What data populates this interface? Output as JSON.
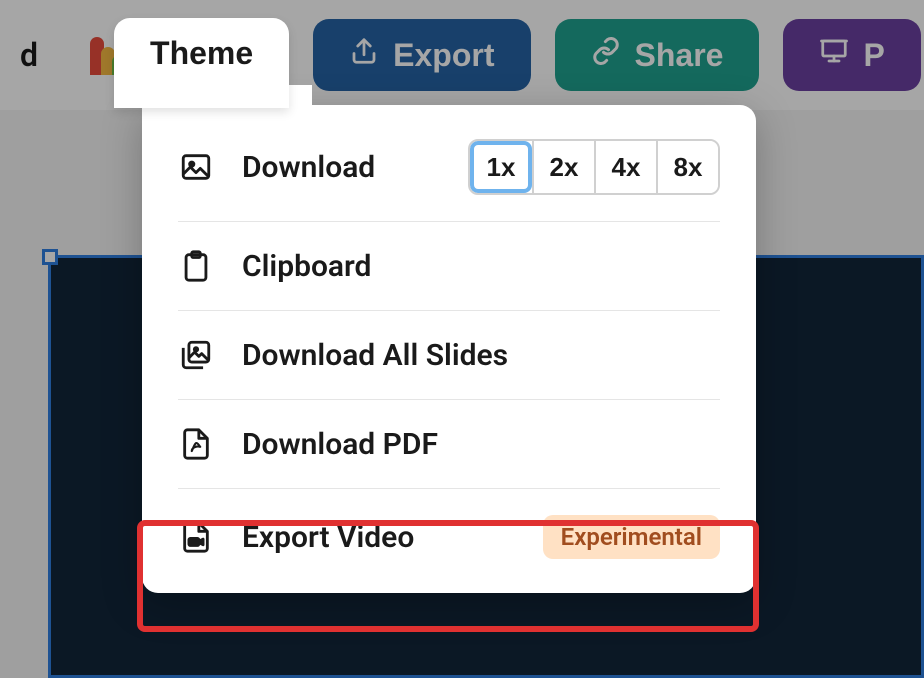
{
  "toolbar": {
    "left_fragment": "d",
    "theme_label": "Theme",
    "export_label": "Export",
    "share_label": "Share",
    "present_fragment": "P"
  },
  "menu": {
    "download": {
      "label": "Download"
    },
    "clipboard": {
      "label": "Clipboard"
    },
    "download_all": {
      "label": "Download All Slides"
    },
    "download_pdf": {
      "label": "Download PDF"
    },
    "export_video": {
      "label": "Export Video",
      "badge": "Experimental"
    }
  },
  "scales": [
    "1x",
    "2x",
    "4x",
    "8x"
  ],
  "selected_scale_index": 0
}
